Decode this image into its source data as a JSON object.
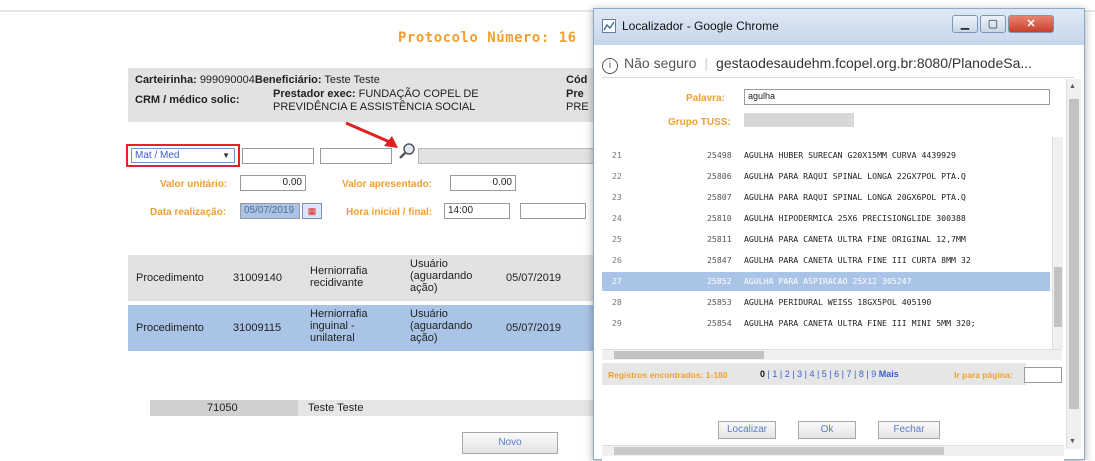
{
  "page": {
    "protocol_title": "Protocolo Número: 16",
    "carteirinha_label": "Carteirinha:",
    "carteirinha_value": "999090004",
    "beneficiario_label": "Beneficiário:",
    "beneficiario_value": "Teste Teste",
    "crm_label": "CRM / médico solic:",
    "prestador_label": "Prestador exec:",
    "prestador_value_line1": "FUNDAÇÃO COPEL DE",
    "prestador_value_line2": "PREVIDÊNCIA E ASSISTÊNCIA SOCIAL",
    "right_cut_1": "Cód",
    "right_cut_2": "Pre",
    "right_cut_3": "PRE",
    "select_value": "Mat / Med",
    "valor_unitario_label": "Valor unitário:",
    "valor_unitario_value": "0.00",
    "valor_apresentado_label": "Valor apresentado:",
    "valor_apresentado_value": "0.00",
    "data_realizacao_label": "Data realização:",
    "data_realizacao_value": "05/07/2019",
    "hora_label": "Hora inicial / final:",
    "hora_inicial_value": "14:00",
    "rows": [
      {
        "tipo": "Procedimento",
        "codigo": "31009140",
        "descricao": "Herniorrafia recidivante",
        "status": "Usuário (aguardando ação)",
        "data": "05/07/2019"
      },
      {
        "tipo": "Procedimento",
        "codigo": "31009115",
        "descricao": "Herniorrafia inguinal - unilateral",
        "status": "Usuário (aguardando ação)",
        "data": "05/07/2019"
      }
    ],
    "footer_code": "71050",
    "footer_name": "Teste Teste",
    "novo_button": "Novo"
  },
  "popup": {
    "title": "Localizador - Google Chrome",
    "not_secure": "Não seguro",
    "url": "gestaodesaudehm.fcopel.org.br:8080/PlanodeSa...",
    "search_label": "Palavra:",
    "search_value": "agulha",
    "grupo_label": "Grupo TUSS:",
    "rows": [
      {
        "num": "21",
        "code": "25498",
        "desc": "AGULHA HUBER SURECAN G20X15MM CURVA 4439929"
      },
      {
        "num": "22",
        "code": "25806",
        "desc": "AGULHA PARA RAQUI SPINAL LONGA 22GX7POL PTA.Q"
      },
      {
        "num": "23",
        "code": "25807",
        "desc": "AGULHA PARA RAQUI SPINAL LONGA 20GX6POL PTA.Q"
      },
      {
        "num": "24",
        "code": "25810",
        "desc": "AGULHA HIPODERMICA 25X6 PRECISIONGLIDE 300388"
      },
      {
        "num": "25",
        "code": "25811",
        "desc": "AGULHA PARA CANETA ULTRA FINE ORIGINAL 12,7MM"
      },
      {
        "num": "26",
        "code": "25847",
        "desc": "AGULHA PARA CANETA ULTRA FINE III CURTA 8MM 32"
      },
      {
        "num": "27",
        "code": "25852",
        "desc": "AGULHA PARA ASPIRACAO 25X12 305247"
      },
      {
        "num": "28",
        "code": "25853",
        "desc": "AGULHA PERIDURAL WEISS 18GX5POL 405190"
      },
      {
        "num": "29",
        "code": "25854",
        "desc": "AGULHA PARA CANETA ULTRA FINE III MINI 5MM 320;"
      }
    ],
    "selected_row": "27",
    "pagination_label": "Registros encontrados: 1-180",
    "pages": [
      "0",
      "1",
      "2",
      "3",
      "4",
      "5",
      "6",
      "7",
      "8",
      "9"
    ],
    "more_label": "Mais",
    "goto_label": "Ir para página:",
    "btn_localizar": "Localizar",
    "btn_ok": "Ok",
    "btn_fechar": "Fechar",
    "colors": {
      "accent": "#f0a030",
      "selection": "#a9c4e6",
      "link": "#3a5fcd"
    }
  }
}
